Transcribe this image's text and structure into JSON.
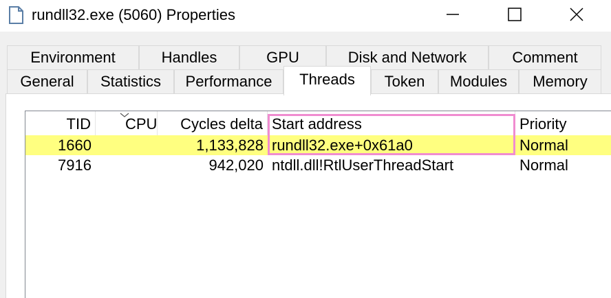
{
  "window": {
    "title": "rundll32.exe (5060) Properties",
    "icon": "document-icon",
    "controls": {
      "minimize": "minimize-icon",
      "maximize": "maximize-icon",
      "close": "close-icon"
    }
  },
  "tabs": {
    "row_top": [
      "Environment",
      "Handles",
      "GPU",
      "Disk and Network",
      "Comment"
    ],
    "row_bottom": [
      "General",
      "Statistics",
      "Performance",
      "Threads",
      "Token",
      "Modules",
      "Memory"
    ],
    "active": "Threads"
  },
  "threads": {
    "columns": [
      "TID",
      "CPU",
      "Cycles delta",
      "Start address",
      "Priority"
    ],
    "rows": [
      {
        "tid": "1660",
        "cpu": "",
        "cycles": "1,133,828",
        "start": "rundll32.exe+0x61a0",
        "priority": "Normal",
        "selected": true
      },
      {
        "tid": "7916",
        "cpu": "",
        "cycles": "942,020",
        "start": "ntdll.dll!RtlUserThreadStart",
        "priority": "Normal",
        "selected": false
      }
    ]
  },
  "colors": {
    "selected_row": "#ffff80",
    "highlight_border": "#f08cd0",
    "tab_border": "#d9d9d9",
    "dialog_bg": "#f0f0f0"
  }
}
